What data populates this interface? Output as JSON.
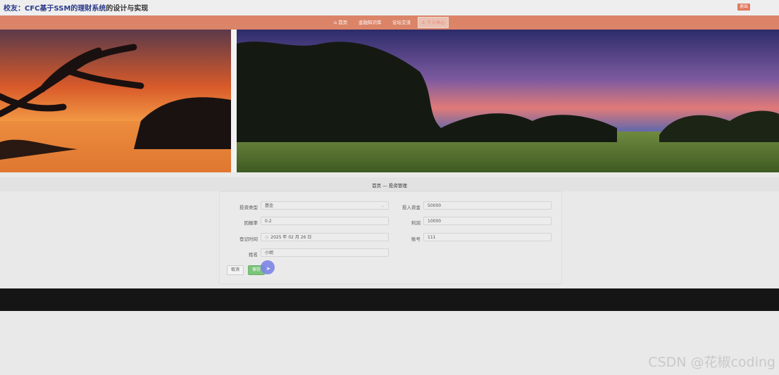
{
  "header": {
    "title_highlight": "校友：CFC基于SSM的理财系统",
    "title_rest": "的设计与实现",
    "logout_label": "退出"
  },
  "nav": {
    "items": [
      {
        "label": "首页"
      },
      {
        "label": "金融知识库"
      },
      {
        "label": "论坛交流"
      },
      {
        "label": "个人中心"
      }
    ]
  },
  "breadcrumb": {
    "home": "首页",
    "separator": "—",
    "current": "投资管理"
  },
  "form": {
    "invest_type": {
      "label": "投资类型",
      "value": "基金"
    },
    "invest_amount": {
      "label": "投入资金",
      "value": "50000"
    },
    "return_rate": {
      "label": "回报率",
      "value": "0.2"
    },
    "profit": {
      "label": "利润",
      "value": "10000"
    },
    "register_time": {
      "label": "登记时间",
      "value": "2025 年 02 月 26 日"
    },
    "account": {
      "label": "账号",
      "value": "111"
    },
    "name": {
      "label": "姓名",
      "value": "小胡"
    },
    "cancel_label": "取消",
    "save_label": "保存"
  },
  "watermark": "CSDN @花椒coding",
  "colors": {
    "nav": "#db8468",
    "save": "#7cc37b",
    "footer": "#151515"
  }
}
